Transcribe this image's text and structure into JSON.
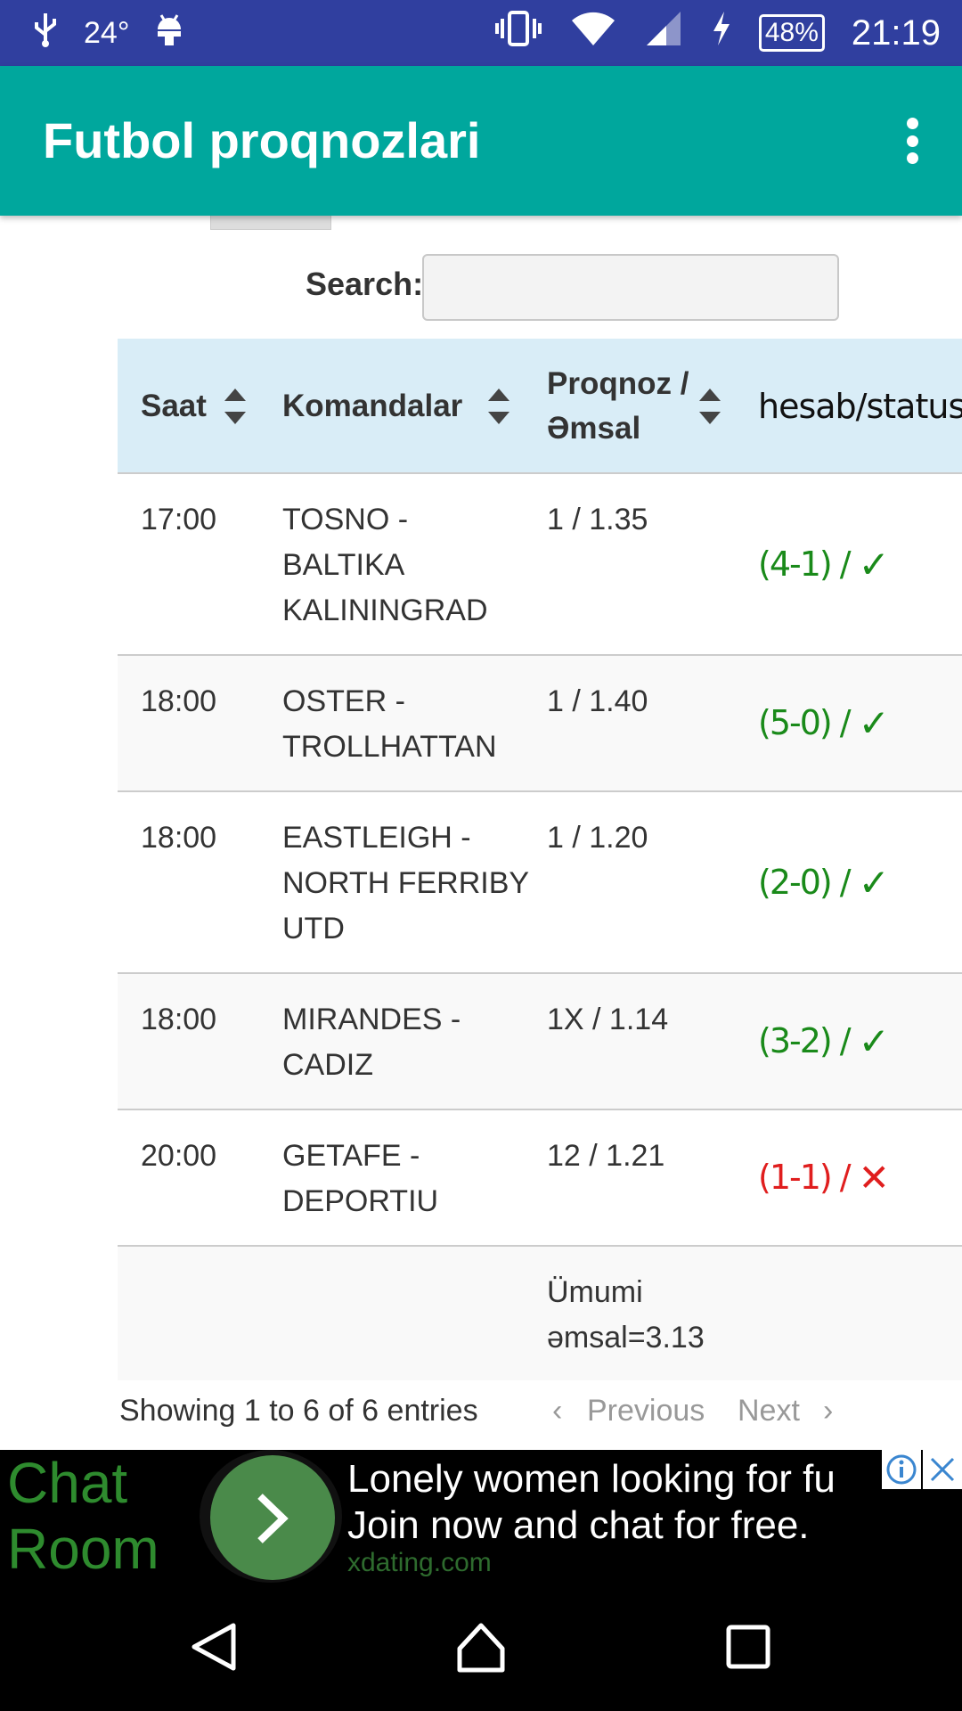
{
  "status_bar": {
    "temperature": "24°",
    "battery": "48%",
    "time": "21:19",
    "icons": [
      "usb-icon",
      "android-icon",
      "vibrate-icon",
      "wifi-icon",
      "signal-icon",
      "charging-icon"
    ]
  },
  "app_bar": {
    "title": "Futbol proqnozlari",
    "menu_icon": "more-vert-icon"
  },
  "search": {
    "label": "Search:",
    "value": ""
  },
  "table": {
    "columns": [
      "Saat",
      "Komandalar",
      "Proqnoz / Əmsal",
      "hesab/status"
    ],
    "rows": [
      {
        "time": "17:00",
        "teams": "TOSNO - BALTIKA KALININGRAD",
        "prediction": "1 / 1.35",
        "score": "(4-1) /",
        "status": "✓",
        "result": "win"
      },
      {
        "time": "18:00",
        "teams": "OSTER - TROLLHATTAN",
        "prediction": "1 / 1.40",
        "score": "(5-0) /",
        "status": "✓",
        "result": "win"
      },
      {
        "time": "18:00",
        "teams": "EASTLEIGH - NORTH FERRIBY UTD",
        "prediction": "1 / 1.20",
        "score": "(2-0) /",
        "status": "✓",
        "result": "win"
      },
      {
        "time": "18:00",
        "teams": "MIRANDES - CADIZ",
        "prediction": "1X / 1.14",
        "score": "(3-2) /",
        "status": "✓",
        "result": "win"
      },
      {
        "time": "20:00",
        "teams": "GETAFE - DEPORTIU",
        "prediction": "12 / 1.21",
        "score": "(1-1) /",
        "status": "✕",
        "result": "loss"
      }
    ],
    "total": "Ümumi əmsal=3.13"
  },
  "pagination": {
    "info": "Showing 1 to 6 of 6 entries",
    "previous": "Previous",
    "next": "Next"
  },
  "ad": {
    "brand": "Chat Room »",
    "line1": "Lonely women looking for fu",
    "line2": "Join now and chat for free.",
    "domain": "xdating.com"
  },
  "colors": {
    "status_bar": "#303f9f",
    "app_bar": "#00a79d",
    "header_bg": "#d9edf7",
    "win": "#1a8a1a",
    "loss": "#e01e1e"
  }
}
